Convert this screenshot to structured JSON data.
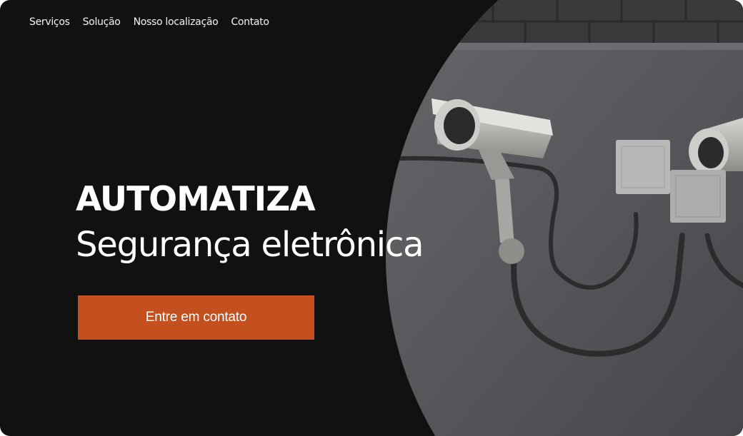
{
  "nav": {
    "items": [
      "Serviços",
      "Solução",
      "Nosso localização",
      "Contato"
    ]
  },
  "hero": {
    "brand": "AUTOMATIZA",
    "subtitle": "Segurança eletrônica",
    "cta_label": "Entre em contato"
  },
  "colors": {
    "background": "#111111",
    "cta": "#c4501f",
    "text": "#ffffff",
    "wall": "#5b5a5e"
  },
  "icons": [
    "security-camera-icon",
    "junction-box-icon"
  ]
}
